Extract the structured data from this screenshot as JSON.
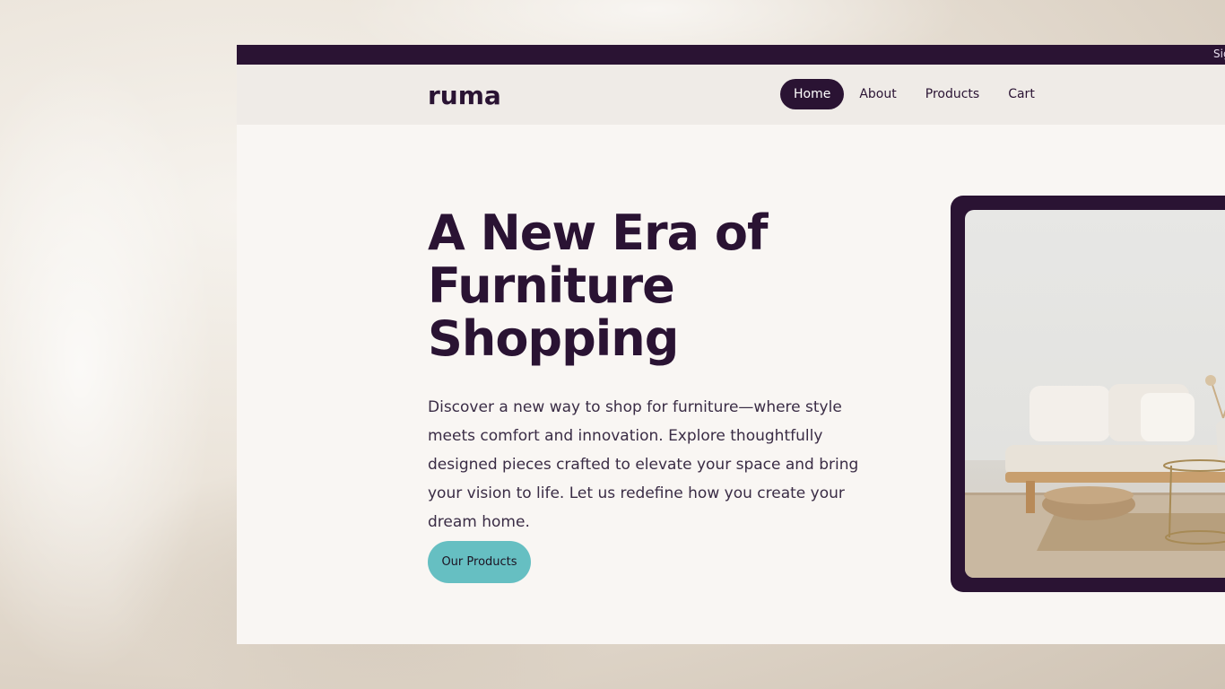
{
  "topbar": {
    "sign_in_label": "Sign In"
  },
  "header": {
    "logo": "ruma",
    "nav": [
      {
        "label": "Home",
        "active": true
      },
      {
        "label": "About",
        "active": false
      },
      {
        "label": "Products",
        "active": false
      },
      {
        "label": "Cart",
        "active": false
      }
    ]
  },
  "hero": {
    "title": "A New Era of Furniture Shopping",
    "description": "Discover a new way to shop for furniture—where style meets comfort and innovation. Explore thoughtfully designed pieces crafted to elevate your space and bring your vision to life. Let us redefine how you create your dream home.",
    "cta_label": "Our Products"
  },
  "colors": {
    "brand_dark": "#2a1333",
    "accent_teal": "#66bfc2",
    "page_bg": "#f9f6f3",
    "navbar_bg": "#efebe7"
  }
}
